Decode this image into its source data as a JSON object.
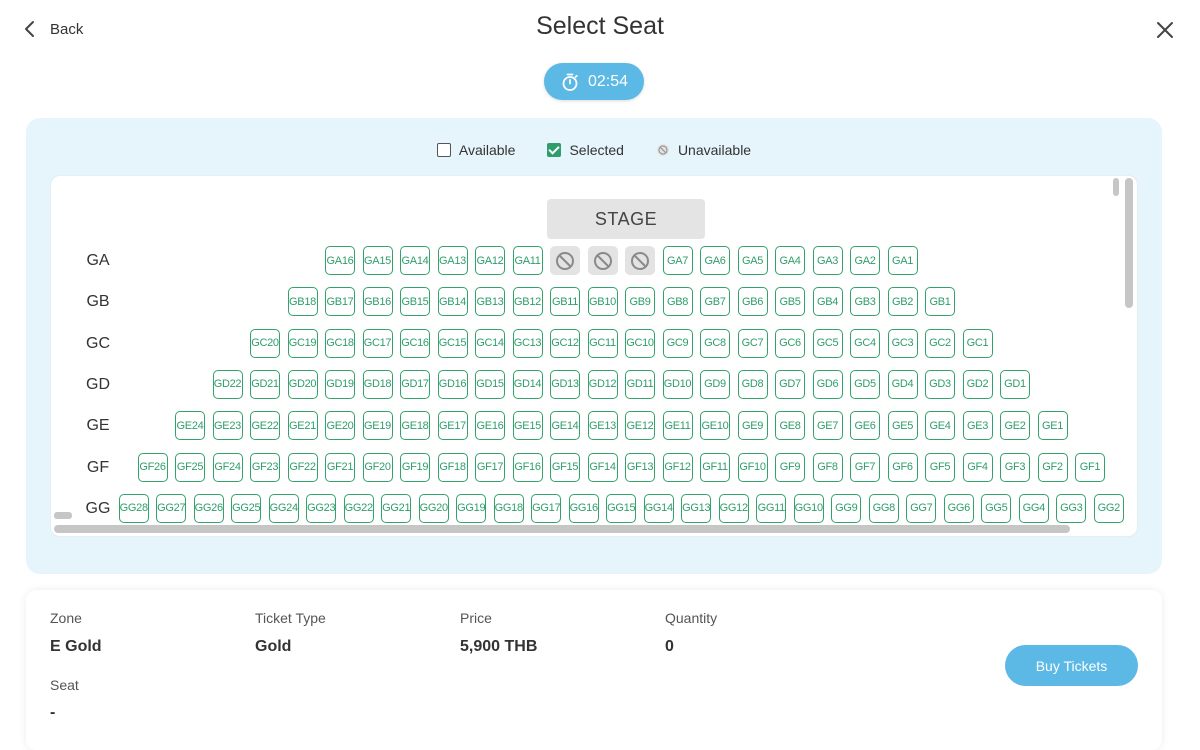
{
  "header": {
    "back_label": "Back",
    "title": "Select Seat"
  },
  "timer": {
    "value": "02:54"
  },
  "legend": {
    "available": "Available",
    "selected": "Selected",
    "unavailable": "Unavailable"
  },
  "stage_label": "STAGE",
  "rows": [
    {
      "label": "GA",
      "seats": [
        "GA16",
        "GA15",
        "GA14",
        "GA13",
        "GA12",
        "GA11",
        "X",
        "X",
        "X",
        "GA7",
        "GA6",
        "GA5",
        "GA4",
        "GA3",
        "GA2",
        "GA1"
      ]
    },
    {
      "label": "GB",
      "seats": [
        "GB18",
        "GB17",
        "GB16",
        "GB15",
        "GB14",
        "GB13",
        "GB12",
        "GB11",
        "GB10",
        "GB9",
        "GB8",
        "GB7",
        "GB6",
        "GB5",
        "GB4",
        "GB3",
        "GB2",
        "GB1"
      ]
    },
    {
      "label": "GC",
      "seats": [
        "GC20",
        "GC19",
        "GC18",
        "GC17",
        "GC16",
        "GC15",
        "GC14",
        "GC13",
        "GC12",
        "GC11",
        "GC10",
        "GC9",
        "GC8",
        "GC7",
        "GC6",
        "GC5",
        "GC4",
        "GC3",
        "GC2",
        "GC1"
      ]
    },
    {
      "label": "GD",
      "seats": [
        "GD22",
        "GD21",
        "GD20",
        "GD19",
        "GD18",
        "GD17",
        "GD16",
        "GD15",
        "GD14",
        "GD13",
        "GD12",
        "GD11",
        "GD10",
        "GD9",
        "GD8",
        "GD7",
        "GD6",
        "GD5",
        "GD4",
        "GD3",
        "GD2",
        "GD1"
      ]
    },
    {
      "label": "GE",
      "seats": [
        "GE24",
        "GE23",
        "GE22",
        "GE21",
        "GE20",
        "GE19",
        "GE18",
        "GE17",
        "GE16",
        "GE15",
        "GE14",
        "GE13",
        "GE12",
        "GE11",
        "GE10",
        "GE9",
        "GE8",
        "GE7",
        "GE6",
        "GE5",
        "GE4",
        "GE3",
        "GE2",
        "GE1"
      ]
    },
    {
      "label": "GF",
      "seats": [
        "GF26",
        "GF25",
        "GF24",
        "GF23",
        "GF22",
        "GF21",
        "GF20",
        "GF19",
        "GF18",
        "GF17",
        "GF16",
        "GF15",
        "GF14",
        "GF13",
        "GF12",
        "GF11",
        "GF10",
        "GF9",
        "GF8",
        "GF7",
        "GF6",
        "GF5",
        "GF4",
        "GF3",
        "GF2",
        "GF1"
      ]
    },
    {
      "label": "GG",
      "seats": [
        "GG28",
        "GG27",
        "GG26",
        "GG25",
        "GG24",
        "GG23",
        "GG22",
        "GG21",
        "GG20",
        "GG19",
        "GG18",
        "GG17",
        "GG16",
        "GG15",
        "GG14",
        "GG13",
        "GG12",
        "GG11",
        "GG10",
        "GG9",
        "GG8",
        "GG7",
        "GG6",
        "GG5",
        "GG4",
        "GG3",
        "GG2"
      ]
    }
  ],
  "info": {
    "zone_label": "Zone",
    "zone_value": "E Gold",
    "ticket_type_label": "Ticket Type",
    "ticket_type_value": "Gold",
    "price_label": "Price",
    "price_value": "5,900 THB",
    "quantity_label": "Quantity",
    "quantity_value": "0",
    "seat_label": "Seat",
    "seat_value": "-"
  },
  "buy_button": "Buy Tickets",
  "colors": {
    "accent": "#5cb8e4",
    "seat_green": "#2e9e6a",
    "panel_bg": "#e6f4fc",
    "unavailable": "#e3e3e3"
  }
}
